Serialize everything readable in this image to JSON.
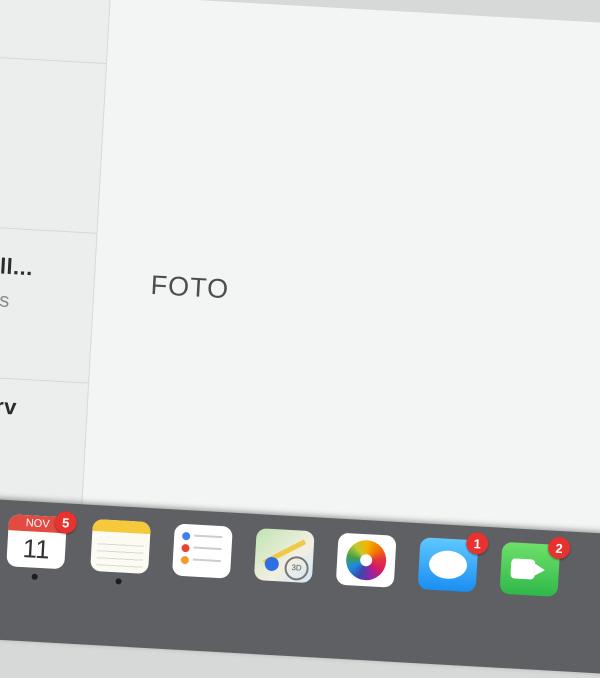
{
  "list": {
    "rows": [
      {
        "title": "",
        "subtitle": ""
      },
      {
        "title": "",
        "subtitle": ""
      },
      {
        "title": "sall...",
        "subtitle": "ales"
      },
      {
        "title": "r crv",
        "subtitle": ""
      }
    ]
  },
  "main": {
    "placeholder_label": "FOTO"
  },
  "dock": {
    "calendar": {
      "month": "NOV",
      "day": "11",
      "badge": "5"
    },
    "messages_badge": "1",
    "facetime_badge": "2",
    "icons": [
      "calendar-icon",
      "notes-icon",
      "reminders-icon",
      "maps-icon",
      "photos-icon",
      "messages-icon",
      "facetime-icon"
    ]
  },
  "colors": {
    "badge": "#e8322f",
    "dock_background": "#5e6064",
    "window_background": "#f3f4f4"
  }
}
